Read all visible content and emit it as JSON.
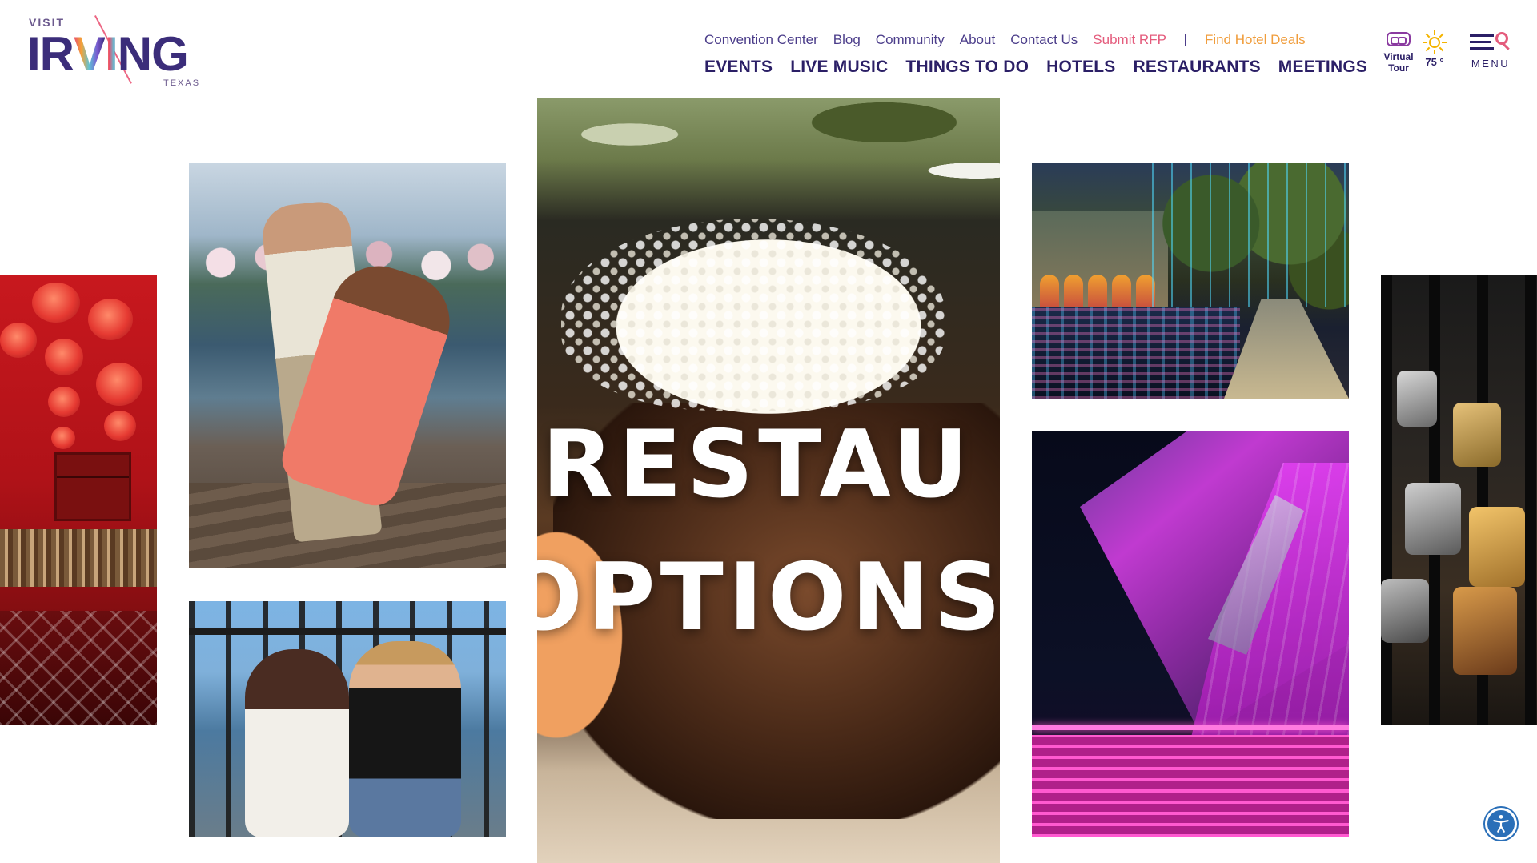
{
  "brand": {
    "visit": "VISIT",
    "letters": [
      "I",
      "R",
      "V",
      "I",
      "N",
      "G"
    ],
    "texas": "TEXAS"
  },
  "topnav": {
    "items": [
      "Convention Center",
      "Blog",
      "Community",
      "About",
      "Contact Us"
    ],
    "rfp": "Submit RFP",
    "deals": "Find Hotel Deals"
  },
  "mainnav": {
    "items": [
      "EVENTS",
      "LIVE MUSIC",
      "THINGS TO DO",
      "HOTELS",
      "RESTAURANTS",
      "MEETINGS"
    ]
  },
  "utility": {
    "virtual_tour": "Virtual Tour",
    "temperature": "75 °",
    "menu_label": "MENU"
  },
  "hero": {
    "video_line1": "RESTAU",
    "video_line2": "OPTIONS"
  },
  "colors": {
    "brand_navy": "#2b1f66",
    "link_purple": "#4b3d8a",
    "rfp_pink": "#e45b7c",
    "deals_orange": "#f09d3c",
    "accessibility_blue": "#2a6fb8"
  },
  "icons": [
    "virtual-tour-goggles-icon",
    "sun-icon",
    "hamburger-icon",
    "search-icon",
    "accessibility-icon"
  ]
}
